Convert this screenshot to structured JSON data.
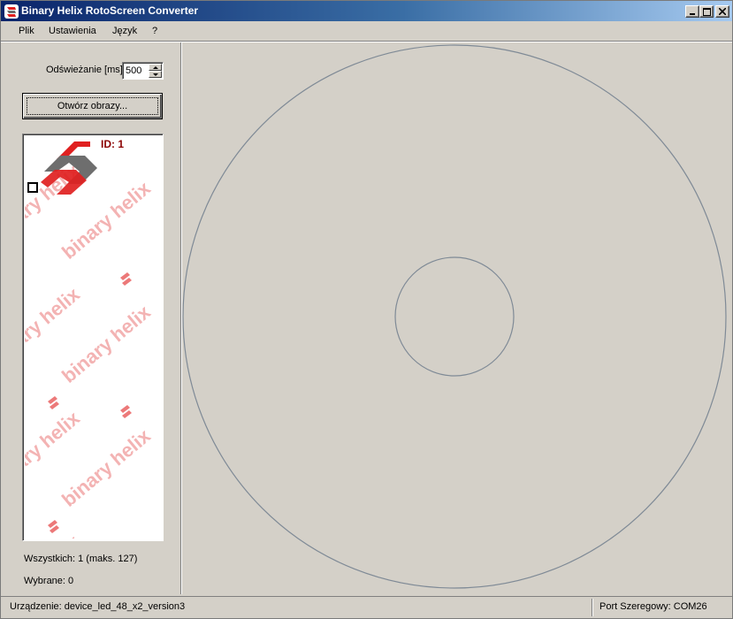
{
  "window": {
    "title": "Binary Helix RotoScreen Converter"
  },
  "menu": {
    "items": [
      "Plik",
      "Ustawienia",
      "Język",
      "?"
    ]
  },
  "left_panel": {
    "refresh_label": "Odświeżanie [ms]",
    "refresh_value": "500",
    "open_button": "Otwórz obrazy...",
    "image_list": {
      "items": [
        {
          "id_label": "ID: 1",
          "checked": false,
          "watermark_text": "binary helix"
        }
      ]
    },
    "count_all": "Wszystkich: 1 (maks. 127)",
    "count_selected": "Wybrane: 0"
  },
  "status": {
    "device": "Urządzenie: device_led_48_x2_version3",
    "serial_port": "Port Szeregowy: COM26"
  },
  "colors": {
    "title_gradient_start": "#0a246a",
    "title_gradient_end": "#a6caf0",
    "face": "#d4d0c8",
    "circle_stroke": "#7f8a96",
    "logo_red": "#e02020",
    "logo_gray": "#6e6e6e",
    "watermark": "#f0a0a0",
    "id_text": "#8b0000"
  }
}
